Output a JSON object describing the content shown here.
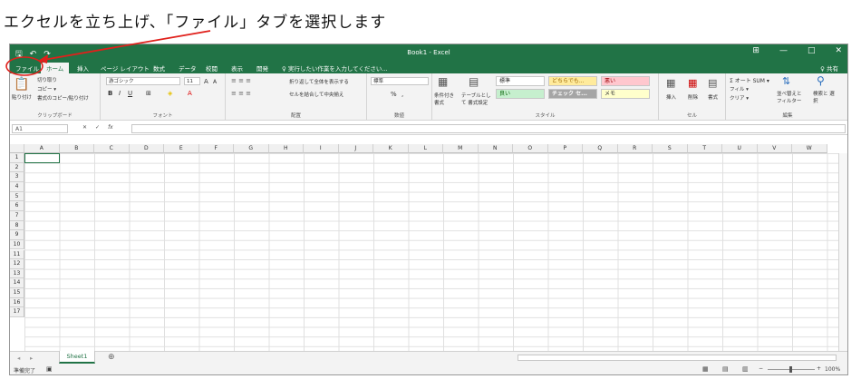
{
  "caption": "エクセルを立ち上げ、「ファイル」タブを選択します",
  "window": {
    "title": "Book1 - Excel",
    "min": "—",
    "restore": "□",
    "close": "✕",
    "ribbon_opts": "⊞"
  },
  "tabs": [
    "ファイル",
    "ホーム",
    "挿入",
    "ページ レイアウト",
    "数式",
    "データ",
    "校閲",
    "表示",
    "開発",
    "♀ 実行したい作業を入力してください..."
  ],
  "share": "♀ 共有",
  "ribbon": {
    "clipboard": {
      "paste": "貼り付け",
      "cut": "切り取り",
      "copy": "コピー ▾",
      "format_painter": "書式のコピー/貼り付け",
      "label": "クリップボード"
    },
    "font": {
      "name": "游ゴシック",
      "size": "11",
      "bold": "B",
      "italic": "I",
      "underline": "U",
      "grow": "A",
      "shrink": "A",
      "label": "フォント"
    },
    "align": {
      "wrap": "折り返して全体を表示する",
      "merge": "セルを結合して中央揃え",
      "label": "配置"
    },
    "number": {
      "format": "標準",
      "percent": "%",
      "comma": ",",
      "label": "数値"
    },
    "styles": {
      "cond": "条件付き 書式",
      "table": "テーブルとして 書式設定",
      "normal": "標準",
      "neutral": "どちらでも...",
      "bad": "悪い",
      "good": "良い",
      "check": "チェック セ...",
      "memo": "メモ",
      "label": "スタイル"
    },
    "cells": {
      "insert": "挿入",
      "delete": "削除",
      "format": "書式",
      "label": "セル"
    },
    "edit": {
      "autosum": "Σ オート SUM ▾",
      "fill": "フィル ▾",
      "clear": "クリア ▾",
      "sort": "並べ替えと フィルター",
      "find": "検索と 選択",
      "label": "編集"
    }
  },
  "formula": {
    "namebox": "A1",
    "cancel": "✕",
    "enter": "✓",
    "fx": "fx"
  },
  "columns": [
    "A",
    "B",
    "C",
    "D",
    "E",
    "F",
    "G",
    "H",
    "I",
    "J",
    "K",
    "L",
    "M",
    "N",
    "O",
    "P",
    "Q",
    "R",
    "S",
    "T",
    "U",
    "V",
    "W"
  ],
  "rows": [
    "1",
    "2",
    "3",
    "4",
    "5",
    "6",
    "7",
    "8",
    "9",
    "10",
    "11",
    "12",
    "13",
    "14",
    "15",
    "16",
    "17"
  ],
  "sheet": {
    "name": "Sheet1",
    "add": "⊕"
  },
  "status": {
    "ready": "準備完了",
    "zoom": "100%"
  },
  "colors": {
    "excel_green": "#217346",
    "annotation_red": "#e0201b"
  }
}
